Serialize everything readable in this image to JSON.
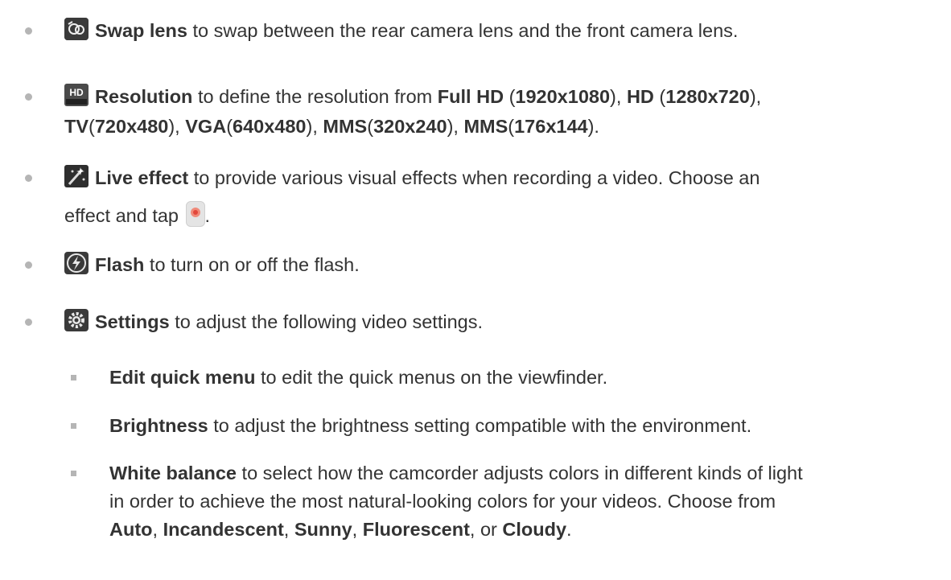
{
  "items": [
    {
      "label": "Swap lens",
      "text": " to swap between the rear camera lens and the front camera lens.",
      "icon": "swap-lens-icon"
    },
    {
      "label": "Resolution",
      "t1": " to define the resolution from ",
      "fullhd": "Full HD",
      "p1": " (",
      "v1": "1920x1080",
      "p2": "), ",
      "hd": "HD",
      "p3": " (",
      "v2": "1280x720",
      "p4": "),",
      "tv": "TV",
      "p5": "(",
      "v3": "720x480",
      "p6": "), ",
      "vga": "VGA",
      "p7": "(",
      "v4": "640x480",
      "p8": "), ",
      "mms1": "MMS",
      "p9": "(",
      "v5": "320x240",
      "p10": "), ",
      "mms2": "MMS",
      "p11": "(",
      "v6": "176x144",
      "p12": ").",
      "icon": "hd-resolution-icon"
    },
    {
      "label": "Live effect",
      "text": " to provide various visual effects when recording a video. Choose an",
      "text2": "effect and tap ",
      "text3": ".",
      "icon": "live-effect-icon"
    },
    {
      "label": "Flash",
      "text": " to turn on or off the flash.",
      "icon": "flash-icon"
    },
    {
      "label": "Settings",
      "text": " to adjust the following video settings.",
      "icon": "settings-gear-icon"
    }
  ],
  "subitems": [
    {
      "label": "Edit quick menu",
      "text": " to edit the quick menus on the viewfinder."
    },
    {
      "label": "Brightness",
      "text": " to adjust the brightness setting compatible with the environment."
    },
    {
      "label": "White balance",
      "text": " to select how the camcorder adjusts colors in different kinds of light",
      "line2": "in order to achieve the most natural-looking colors for your videos. Choose from",
      "auto": "Auto",
      "c1": ", ",
      "inc": "Incandescent",
      "c2": ", ",
      "sunny": "Sunny",
      "c3": ", ",
      "fluo": "Fluorescent",
      "c4": ", or ",
      "cloudy": "Cloudy",
      "end": "."
    }
  ]
}
